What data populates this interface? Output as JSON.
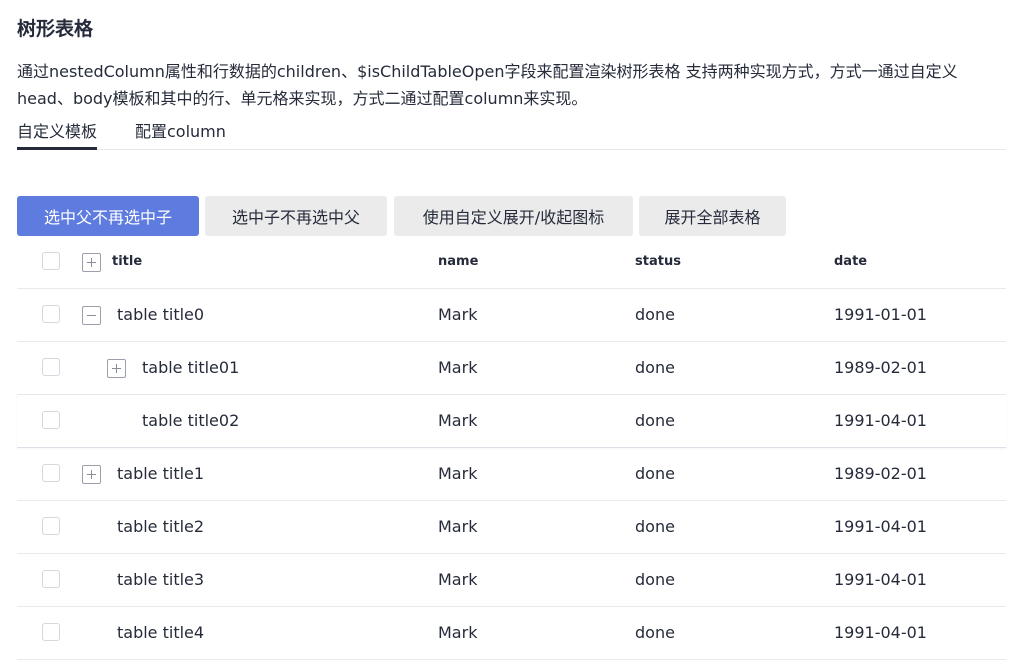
{
  "page": {
    "title": "树形表格",
    "description": "通过nestedColumn属性和行数据的children、$isChildTableOpen字段来配置渲染树形表格 支持两种实现方式，方式一通过自定义head、body模板和其中的行、单元格来实现，方式二通过配置column来实现。"
  },
  "tabs": [
    {
      "label": "自定义模板",
      "active": true
    },
    {
      "label": "配置column",
      "active": false
    }
  ],
  "buttons": [
    {
      "label": "选中父不再选中子",
      "primary": true
    },
    {
      "label": "选中子不再选中父",
      "primary": false
    },
    {
      "label": "使用自定义展开/收起图标",
      "primary": false
    },
    {
      "label": "展开全部表格",
      "primary": false
    }
  ],
  "table": {
    "columns": [
      "title",
      "name",
      "status",
      "date"
    ],
    "rows": [
      {
        "title": "table title0",
        "name": "Mark",
        "status": "done",
        "date": "1991-01-01",
        "level": 0,
        "toggle": "expanded"
      },
      {
        "title": "table title01",
        "name": "Mark",
        "status": "done",
        "date": "1989-02-01",
        "level": 1,
        "toggle": "collapsed"
      },
      {
        "title": "table title02",
        "name": "Mark",
        "status": "done",
        "date": "1991-04-01",
        "level": 1,
        "toggle": "none"
      },
      {
        "title": "table title1",
        "name": "Mark",
        "status": "done",
        "date": "1989-02-01",
        "level": 0,
        "toggle": "collapsed"
      },
      {
        "title": "table title2",
        "name": "Mark",
        "status": "done",
        "date": "1991-04-01",
        "level": 0,
        "toggle": "none"
      },
      {
        "title": "table title3",
        "name": "Mark",
        "status": "done",
        "date": "1991-04-01",
        "level": 0,
        "toggle": "none"
      },
      {
        "title": "table title4",
        "name": "Mark",
        "status": "done",
        "date": "1991-04-01",
        "level": 0,
        "toggle": "none"
      }
    ]
  },
  "colors": {
    "primary": "#5e7ce0",
    "text": "#252b3a",
    "button_bg": "#ebebeb",
    "border": "#e7e9ee"
  }
}
